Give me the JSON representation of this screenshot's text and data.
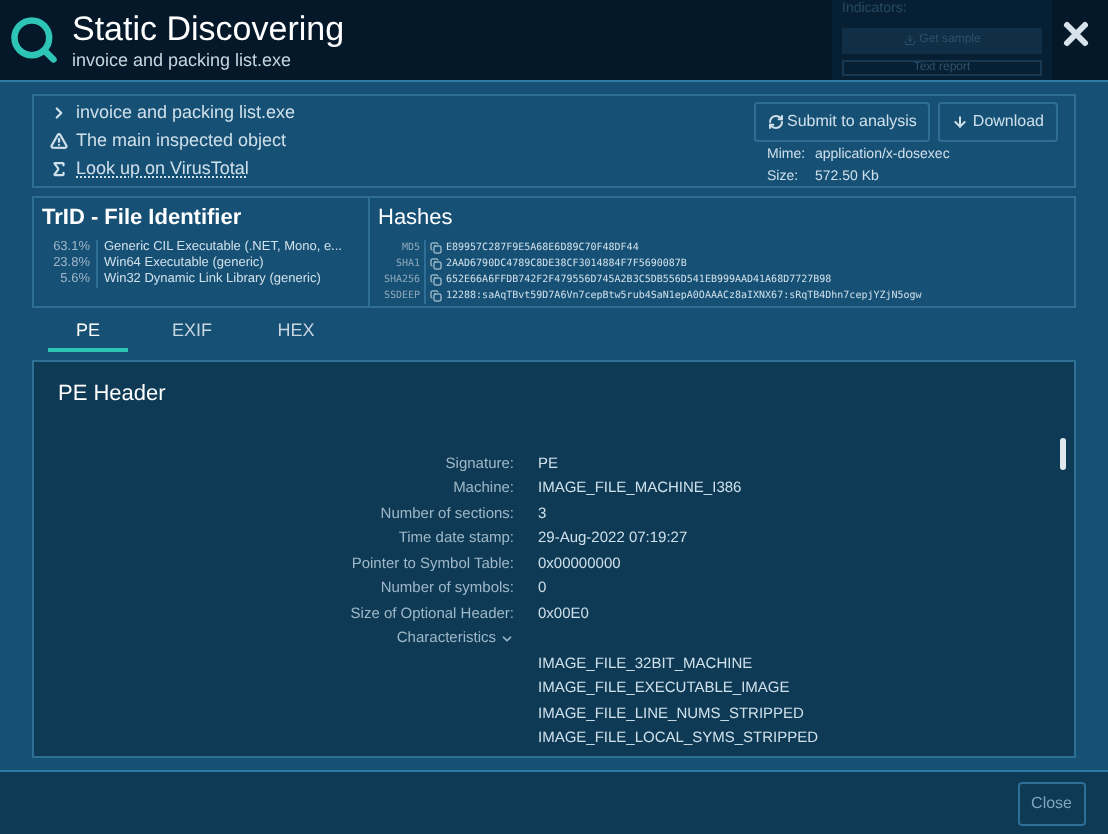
{
  "header": {
    "title": "Static Discovering",
    "subtitle": "invoice and packing list.exe"
  },
  "background": {
    "indicators_label": "Indicators:",
    "get_sample": "Get sample",
    "text_report": "Text report"
  },
  "object": {
    "items": [
      {
        "kind": "file",
        "text": "invoice and packing list.exe"
      },
      {
        "kind": "warning",
        "text": "The main inspected object"
      },
      {
        "kind": "lookup",
        "text": "Look up on VirusTotal"
      }
    ],
    "actions": [
      {
        "kind": "submit",
        "label": "Submit to analysis"
      },
      {
        "kind": "download",
        "label": "Download"
      }
    ],
    "mime_label": "Mime:",
    "mime": "application/x-dosexec",
    "size_label": "Size:",
    "size": "572.50 Kb"
  },
  "trid": {
    "title": "TrID - File Identifier",
    "rows": [
      {
        "percent": "63.1%",
        "type": "Generic CIL Executable (.NET, Mono, e..."
      },
      {
        "percent": "23.8%",
        "type": "Win64 Executable (generic)"
      },
      {
        "percent": "5.6%",
        "type": "Win32 Dynamic Link Library (generic)"
      }
    ]
  },
  "hashes": {
    "title": "Hashes",
    "rows": [
      {
        "algo": "MD5",
        "value": "E89957C287F9E5A68E6D89C70F48DF44"
      },
      {
        "algo": "SHA1",
        "value": "2AAD6790DC4789C8DE38CF3014884F7F5690087B"
      },
      {
        "algo": "SHA256",
        "value": "652E66A6FFDB742F2F479556D745A2B3C5DB556D541EB999AAD41A68D7727B98"
      },
      {
        "algo": "SSDEEP",
        "value": "12288:saAqTBvt59D7A6Vn7cepBtw5rub4SaN1epA0OAAACz8aIXNX67:sRqTB4Dhn7cepjYZjN5ogw"
      }
    ]
  },
  "tabs": [
    {
      "label": "PE",
      "selected": true
    },
    {
      "label": "EXIF",
      "selected": false
    },
    {
      "label": "HEX",
      "selected": false
    }
  ],
  "pe_header": {
    "title": "PE Header",
    "fields": [
      {
        "label": "Signature:",
        "value": "PE"
      },
      {
        "label": "Machine:",
        "value": "IMAGE_FILE_MACHINE_I386"
      },
      {
        "label": "Number of sections:",
        "value": "3"
      },
      {
        "label": "Time date stamp:",
        "value": "29-Aug-2022 07:19:27"
      },
      {
        "label": "Pointer to Symbol Table:",
        "value": "0x00000000"
      },
      {
        "label": "Number of symbols:",
        "value": "0"
      },
      {
        "label": "Size of Optional Header:",
        "value": "0x00E0"
      }
    ],
    "characteristics": {
      "label": "Characteristics",
      "expanded": true,
      "values": [
        "IMAGE_FILE_32BIT_MACHINE",
        "IMAGE_FILE_EXECUTABLE_IMAGE",
        "IMAGE_FILE_LINE_NUMS_STRIPPED",
        "IMAGE_FILE_LOCAL_SYMS_STRIPPED"
      ]
    }
  },
  "footer": {
    "close": "Close"
  }
}
